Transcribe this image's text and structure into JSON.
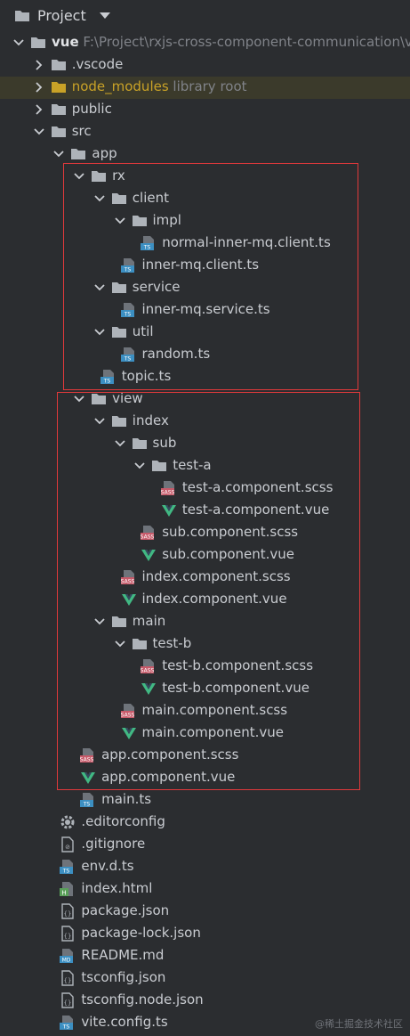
{
  "header": {
    "title": "Project"
  },
  "tree": [
    {
      "name": "vue",
      "path": "F:\\Project\\rxjs-cross-component-communication\\vu",
      "type": "folder",
      "open": true,
      "depth": 0,
      "bold": true
    },
    {
      "name": ".vscode",
      "type": "folder",
      "open": false,
      "depth": 1
    },
    {
      "name": "node_modules",
      "extra": "library root",
      "type": "folder-lib",
      "open": false,
      "depth": 1,
      "highlight": true
    },
    {
      "name": "public",
      "type": "folder",
      "open": false,
      "depth": 1
    },
    {
      "name": "src",
      "type": "folder",
      "open": true,
      "depth": 1
    },
    {
      "name": "app",
      "type": "folder",
      "open": true,
      "depth": 2
    },
    {
      "name": "rx",
      "type": "folder",
      "open": true,
      "depth": 3
    },
    {
      "name": "client",
      "type": "folder",
      "open": true,
      "depth": 4
    },
    {
      "name": "impl",
      "type": "folder",
      "open": true,
      "depth": 5
    },
    {
      "name": "normal-inner-mq.client.ts",
      "type": "ts",
      "depth": 6
    },
    {
      "name": "inner-mq.client.ts",
      "type": "ts",
      "depth": 5
    },
    {
      "name": "service",
      "type": "folder",
      "open": true,
      "depth": 4
    },
    {
      "name": "inner-mq.service.ts",
      "type": "ts",
      "depth": 5
    },
    {
      "name": "util",
      "type": "folder",
      "open": true,
      "depth": 4
    },
    {
      "name": "random.ts",
      "type": "ts",
      "depth": 5
    },
    {
      "name": "topic.ts",
      "type": "ts",
      "depth": 4
    },
    {
      "name": "view",
      "type": "folder",
      "open": true,
      "depth": 3
    },
    {
      "name": "index",
      "type": "folder",
      "open": true,
      "depth": 4
    },
    {
      "name": "sub",
      "type": "folder",
      "open": true,
      "depth": 5
    },
    {
      "name": "test-a",
      "type": "folder",
      "open": true,
      "depth": 6
    },
    {
      "name": "test-a.component.scss",
      "type": "sass",
      "depth": 7
    },
    {
      "name": "test-a.component.vue",
      "type": "vue",
      "depth": 7
    },
    {
      "name": "sub.component.scss",
      "type": "sass",
      "depth": 6
    },
    {
      "name": "sub.component.vue",
      "type": "vue",
      "depth": 6
    },
    {
      "name": "index.component.scss",
      "type": "sass",
      "depth": 5
    },
    {
      "name": "index.component.vue",
      "type": "vue",
      "depth": 5
    },
    {
      "name": "main",
      "type": "folder",
      "open": true,
      "depth": 4
    },
    {
      "name": "test-b",
      "type": "folder",
      "open": true,
      "depth": 5
    },
    {
      "name": "test-b.component.scss",
      "type": "sass",
      "depth": 6
    },
    {
      "name": "test-b.component.vue",
      "type": "vue",
      "depth": 6
    },
    {
      "name": "main.component.scss",
      "type": "sass",
      "depth": 5
    },
    {
      "name": "main.component.vue",
      "type": "vue",
      "depth": 5
    },
    {
      "name": "app.component.scss",
      "type": "sass",
      "depth": 3
    },
    {
      "name": "app.component.vue",
      "type": "vue",
      "depth": 3
    },
    {
      "name": "main.ts",
      "type": "ts",
      "depth": 3
    },
    {
      "name": ".editorconfig",
      "type": "gear",
      "depth": 2
    },
    {
      "name": ".gitignore",
      "type": "ignore",
      "depth": 2
    },
    {
      "name": "env.d.ts",
      "type": "ts",
      "depth": 2
    },
    {
      "name": "index.html",
      "type": "html",
      "depth": 2
    },
    {
      "name": "package.json",
      "type": "json",
      "depth": 2
    },
    {
      "name": "package-lock.json",
      "type": "json",
      "depth": 2
    },
    {
      "name": "README.md",
      "type": "md",
      "depth": 2
    },
    {
      "name": "tsconfig.json",
      "type": "json",
      "depth": 2
    },
    {
      "name": "tsconfig.node.json",
      "type": "json",
      "depth": 2
    },
    {
      "name": "vite.config.ts",
      "type": "ts",
      "depth": 2
    }
  ],
  "watermark": "@稀土掘金技术社区",
  "colors": {
    "folder": "#aeb3b9",
    "folder_lib": "#c9a227",
    "ts_badge": "#3c8fc2",
    "sass_badge": "#c75a6a",
    "vue_green": "#41b883",
    "highlight_bg": "#3b3a2b",
    "red_box": "#e0393b"
  }
}
